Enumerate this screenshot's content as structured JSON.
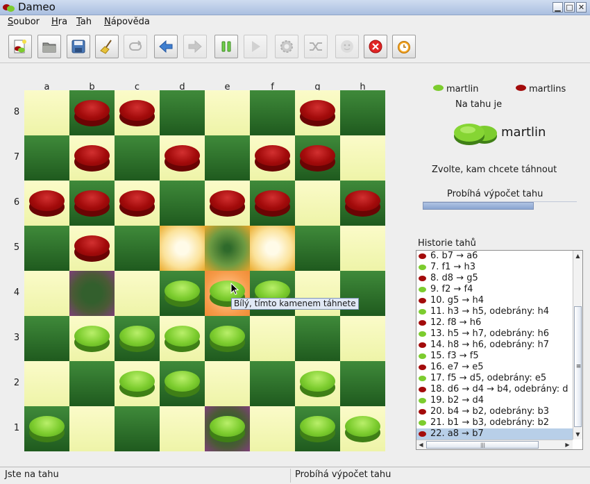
{
  "window": {
    "title": "Dameo",
    "min_glyph": "▁",
    "max_glyph": "□",
    "close_glyph": "✕"
  },
  "menu": [
    {
      "label": "Soubor",
      "underline": "S"
    },
    {
      "label": "Hra",
      "underline": "H"
    },
    {
      "label": "Tah",
      "underline": "T"
    },
    {
      "label": "Nápověda",
      "underline": "N"
    }
  ],
  "toolbar": [
    {
      "name": "new-game-button",
      "icon": "new-game-icon",
      "enabled": true
    },
    {
      "name": "open-button",
      "icon": "folder-icon",
      "enabled": true
    },
    {
      "name": "save-button",
      "icon": "floppy-icon",
      "enabled": true
    },
    {
      "name": "clear-button",
      "icon": "broom-icon",
      "enabled": true
    },
    {
      "name": "loop-button",
      "icon": "loop-icon",
      "enabled": false
    },
    {
      "name": "undo-button",
      "icon": "arrow-left-icon",
      "enabled": true
    },
    {
      "name": "redo-button",
      "icon": "arrow-right-icon",
      "enabled": false
    },
    {
      "name": "pause-button",
      "icon": "pause-icon",
      "enabled": true
    },
    {
      "name": "play-button",
      "icon": "play-icon",
      "enabled": false
    },
    {
      "name": "settings-button",
      "icon": "gear-icon",
      "enabled": false
    },
    {
      "name": "shuffle-button",
      "icon": "shuffle-icon",
      "enabled": false
    },
    {
      "name": "hint-button",
      "icon": "smiley-icon",
      "enabled": false
    },
    {
      "name": "stop-button",
      "icon": "stop-icon",
      "enabled": true
    },
    {
      "name": "timer-button",
      "icon": "clock-icon",
      "enabled": true
    }
  ],
  "board": {
    "columns": [
      "a",
      "b",
      "c",
      "d",
      "e",
      "f",
      "g",
      "h"
    ],
    "rows": [
      "8",
      "7",
      "6",
      "5",
      "4",
      "3",
      "2",
      "1"
    ],
    "pieces": [
      "-RR---R-",
      "-R-R-RR-",
      "RRR-RR-R",
      "-R------",
      "---GGG--",
      "-GGGG---",
      "--GG--G-",
      "G---G-GG"
    ],
    "highlights": [
      {
        "square": "d5",
        "kind": "yellow"
      },
      {
        "square": "e5",
        "kind": "dark"
      },
      {
        "square": "f5",
        "kind": "yellow"
      },
      {
        "square": "e4",
        "kind": "orange"
      },
      {
        "square": "b4",
        "kind": "purple"
      },
      {
        "square": "e1",
        "kind": "purple"
      }
    ],
    "tooltip": "Bílý, tímto kamenem táhnete"
  },
  "colors": {
    "red": "#a30b0b",
    "green": "#7ccc2e",
    "light_square": "#f6f8b8",
    "dark_square": "#2f7a2c"
  },
  "players": {
    "green": "martlin",
    "red": "martlins"
  },
  "turn": {
    "label": "Na tahu je",
    "current": "martlin"
  },
  "instruction": "Zvolte, kam chcete táhnout",
  "calculation": {
    "label": "Probíhá výpočet tahu",
    "progress": 0.72
  },
  "history": {
    "title": "Historie tahů",
    "moves": [
      {
        "color": "red",
        "text": "6. b7 → a6"
      },
      {
        "color": "green",
        "text": "7. f1 → h3"
      },
      {
        "color": "red",
        "text": "8. d8 → g5"
      },
      {
        "color": "green",
        "text": "9. f2 → f4"
      },
      {
        "color": "red",
        "text": "10. g5 → h4"
      },
      {
        "color": "green",
        "text": "11. h3 → h5, odebrány: h4"
      },
      {
        "color": "red",
        "text": "12. f8 → h6"
      },
      {
        "color": "green",
        "text": "13. h5 → h7, odebrány: h6"
      },
      {
        "color": "red",
        "text": "14. h8 → h6, odebrány: h7"
      },
      {
        "color": "green",
        "text": "15. f3 → f5"
      },
      {
        "color": "red",
        "text": "16. e7 → e5"
      },
      {
        "color": "green",
        "text": "17. f5 → d5, odebrány: e5"
      },
      {
        "color": "red",
        "text": "18. d6 → d4 → b4, odebrány: d"
      },
      {
        "color": "green",
        "text": "19. b2 → d4"
      },
      {
        "color": "red",
        "text": "20. b4 → b2, odebrány: b3"
      },
      {
        "color": "green",
        "text": "21. b1 → b3, odebrány: b2"
      },
      {
        "color": "red",
        "text": "22. a8 → b7"
      }
    ],
    "selected_index": 16,
    "scroll": {
      "up": "▲",
      "down": "▼",
      "left": "◀",
      "right": "▶",
      "grip_v": "≡",
      "grip_h": "|||"
    }
  },
  "status": {
    "left": "Jste na tahu",
    "right": "Probíhá výpočet tahu"
  }
}
